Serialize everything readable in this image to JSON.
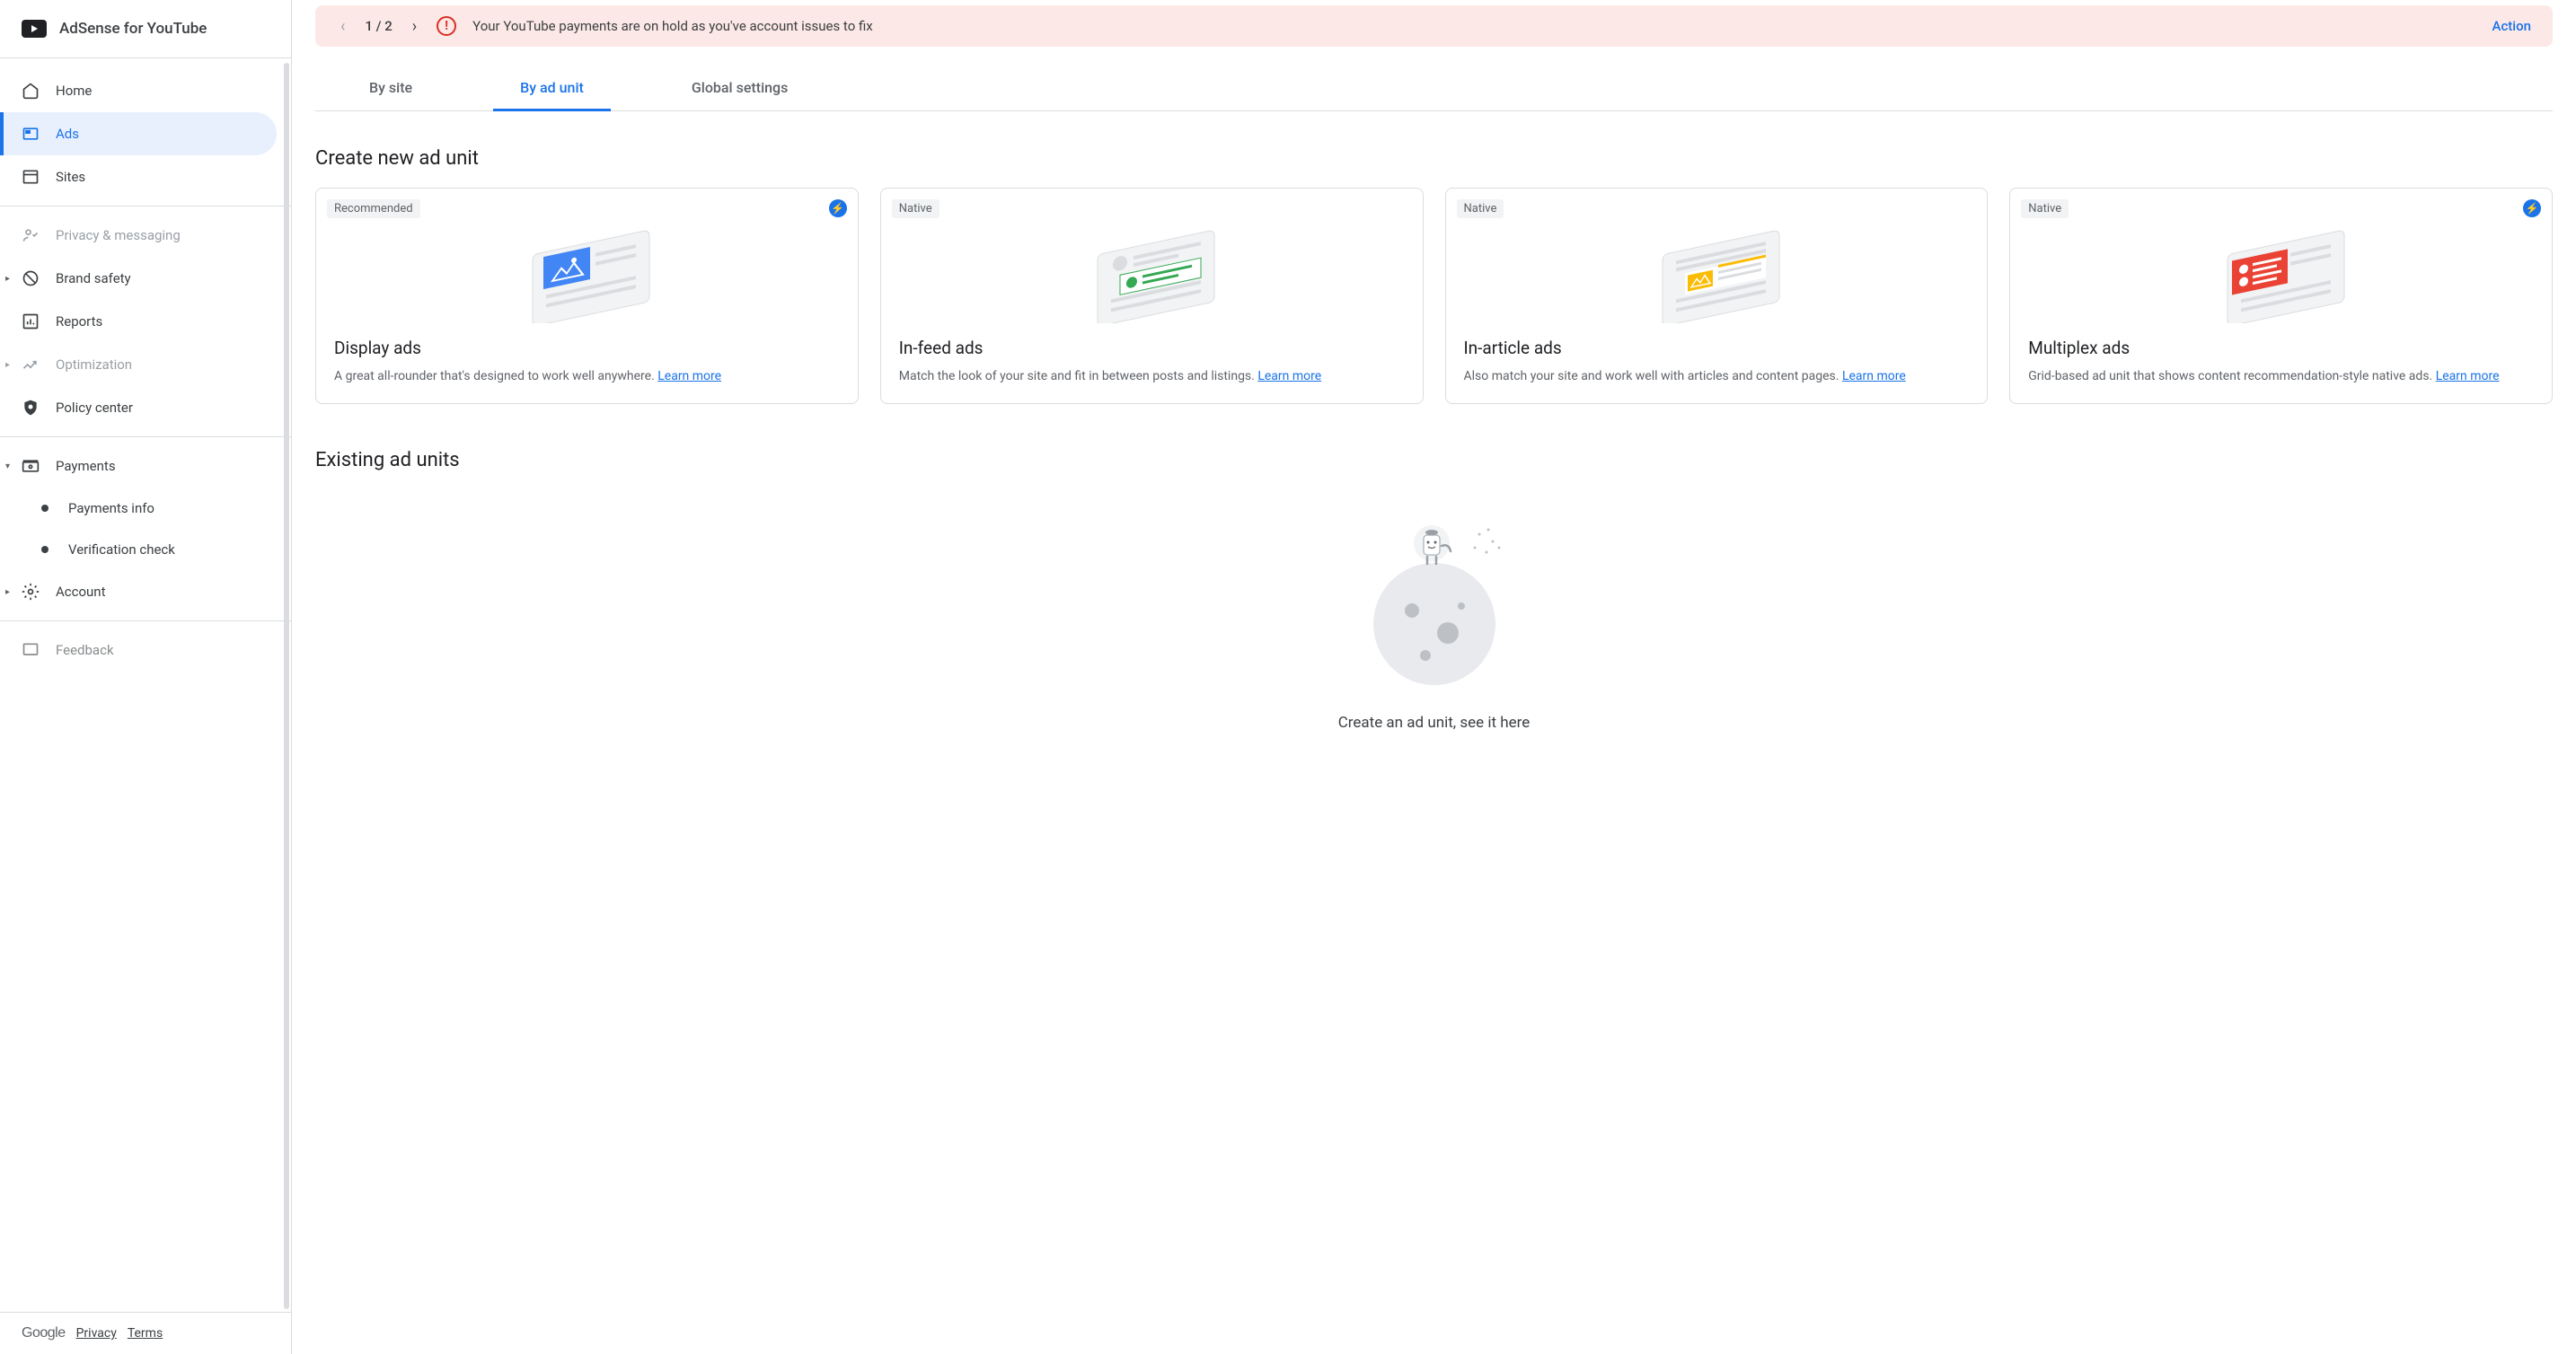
{
  "header": {
    "title": "AdSense for YouTube"
  },
  "sidebar": {
    "items": [
      {
        "label": "Home"
      },
      {
        "label": "Ads"
      },
      {
        "label": "Sites"
      },
      {
        "label": "Privacy & messaging"
      },
      {
        "label": "Brand safety"
      },
      {
        "label": "Reports"
      },
      {
        "label": "Optimization"
      },
      {
        "label": "Policy center"
      },
      {
        "label": "Payments"
      },
      {
        "label": "Payments info"
      },
      {
        "label": "Verification check"
      },
      {
        "label": "Account"
      },
      {
        "label": "Feedback"
      }
    ],
    "footer": {
      "logo": "Google",
      "privacy": "Privacy",
      "terms": "Terms"
    }
  },
  "alert": {
    "pager": "1 / 2",
    "message": "Your YouTube payments are on hold as you've account issues to fix",
    "action": "Action"
  },
  "tabs": [
    {
      "label": "By site"
    },
    {
      "label": "By ad unit"
    },
    {
      "label": "Global settings"
    }
  ],
  "sections": {
    "create_title": "Create new ad unit",
    "existing_title": "Existing ad units"
  },
  "cards": [
    {
      "badge": "Recommended",
      "title": "Display ads",
      "desc": "A great all-rounder that's designed to work well anywhere. ",
      "learn": "Learn more",
      "amp": true,
      "color": "#4285f4"
    },
    {
      "badge": "Native",
      "title": "In-feed ads",
      "desc": "Match the look of your site and fit in between posts and listings. ",
      "learn": "Learn more",
      "amp": false,
      "color": "#34a853"
    },
    {
      "badge": "Native",
      "title": "In-article ads",
      "desc": "Also match your site and work well with articles and content pages. ",
      "learn": "Learn more",
      "amp": false,
      "color": "#fbbc04"
    },
    {
      "badge": "Native",
      "title": "Multiplex ads",
      "desc": "Grid-based ad unit that shows content recommendation-style native ads. ",
      "learn": "Learn more",
      "amp": true,
      "color": "#ea4335"
    }
  ],
  "empty": {
    "text": "Create an ad unit, see it here"
  }
}
